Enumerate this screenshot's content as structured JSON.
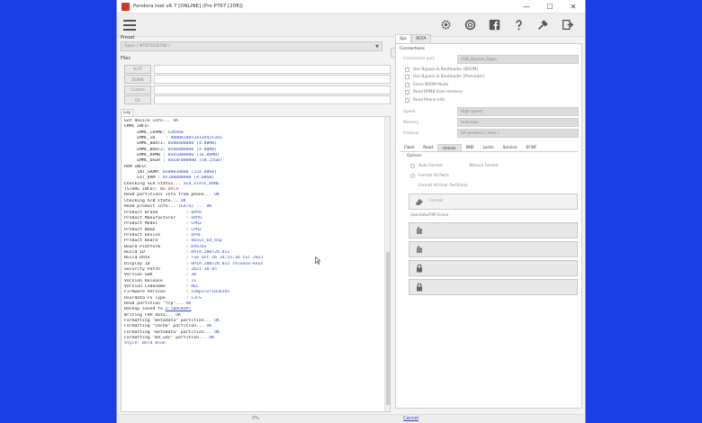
{
  "window": {
    "title": "Pandora tool v6.7 [ONLINE] (Pro P767 [208])",
    "minimize": "—",
    "maximize": "☐",
    "close": "✕"
  },
  "toolbar": {
    "icons": [
      "gear-icon",
      "lifebuoy-icon",
      "facebook-icon",
      "help-icon",
      "tools-icon",
      "export-icon"
    ]
  },
  "left": {
    "preset_label": "Preset",
    "preset_value": "Oppo  ( MT6765/6768 )",
    "files_label": "Files",
    "file_buttons": [
      "SCAT",
      "DOWN",
      "Custom",
      "DA"
    ],
    "log_tab": "Log"
  },
  "log": {
    "lines": [
      [
        [
          "Get device info... ",
          "k"
        ],
        [
          "OK",
          "v"
        ]
      ],
      [
        [
          "EMMC INFO:",
          "k"
        ]
      ],
      [
        [
          "     EMMC_CHAME: ",
          "k"
        ],
        [
          "G1K9da",
          "v"
        ]
      ],
      [
        [
          "     EMMC_ID    : ",
          "k"
        ],
        [
          "9B0B0100534134425341",
          "v"
        ]
      ],
      [
        [
          "     EMMC_BOOT1: ",
          "k"
        ],
        [
          "0x00400000 (4.00MB)",
          "v"
        ]
      ],
      [
        [
          "     EMMC_BOOT2: ",
          "k"
        ],
        [
          "0x00400000 (4.00MB)",
          "v"
        ]
      ],
      [
        [
          "     EMMC_RPMB : ",
          "k"
        ],
        [
          "0x01000000 (16.00MB)",
          "v"
        ]
      ],
      [
        [
          "     EMMC_USER : ",
          "k"
        ],
        [
          "0xE8F000000 (58.25GB)",
          "v"
        ]
      ],
      [
        [
          "RAM INFO:",
          "k"
        ]
      ],
      [
        [
          "     INT_SRAM: ",
          "k"
        ],
        [
          "0x00038000 (224.00KB)",
          "v"
        ]
      ],
      [
        [
          "     EXT_RAM : ",
          "k"
        ],
        [
          "0x100000000 (4.00GB)",
          "v"
        ]
      ],
      [
        [
          "Checking SLA status... ",
          "k"
        ],
        [
          "SLA_STATE_DONE",
          "v"
        ]
      ],
      [
        [
          "[STORE INFO]: ",
          "k"
        ],
        [
          "NO DATA",
          "r"
        ]
      ],
      [
        [
          "Read partitions info from phone... ",
          "k"
        ],
        [
          "OK",
          "v"
        ]
      ],
      [
        [
          "Checking A/B state... ",
          "k"
        ],
        [
          "OK",
          "v"
        ]
      ],
      [
        [
          "Read product info... ",
          "k"
        ],
        [
          "[EXT4] ... OK",
          "v"
        ]
      ],
      [
        [
          "Product Brand           : ",
          "k"
        ],
        [
          "OPPO",
          "v"
        ]
      ],
      [
        [
          "Product Manufacturer    : ",
          "k"
        ],
        [
          "OPPO",
          "v"
        ]
      ],
      [
        [
          "Product Model           : ",
          "k"
        ],
        [
          "CPH2",
          "v"
        ]
      ],
      [
        [
          "Product Name            : ",
          "k"
        ],
        [
          "CPH2",
          "v"
        ]
      ],
      [
        [
          "Product Device          : ",
          "k"
        ],
        [
          "OP4F",
          "v"
        ]
      ],
      [
        [
          "Product Board           : ",
          "k"
        ],
        [
          "k65v1_64_bsp",
          "v"
        ]
      ],
      [
        [
          "Board Platform          : ",
          "k"
        ],
        [
          "mt6765",
          "v"
        ]
      ],
      [
        [
          "Build ID                : ",
          "k"
        ],
        [
          "RP1A.200720.011",
          "v"
        ]
      ],
      [
        [
          "Build Date              : ",
          "k"
        ],
        [
          "Tue Oct 26 14:55:36 CST 2021",
          "v"
        ]
      ],
      [
        [
          "Display ID              : ",
          "k"
        ],
        [
          "RP1A.200720.011 release-keys",
          "v"
        ]
      ],
      [
        [
          "Security Patch          : ",
          "k"
        ],
        [
          "2021-10-05",
          "v"
        ]
      ],
      [
        [
          "Version SDK             : ",
          "k"
        ],
        [
          "30",
          "v"
        ]
      ],
      [
        [
          "Version Release         : ",
          "k"
        ],
        [
          "11",
          "v"
        ]
      ],
      [
        [
          "Version Codename        : ",
          "k"
        ],
        [
          "REL",
          "v"
        ]
      ],
      [
        [
          "Firmware Version        : ",
          "k"
        ],
        [
          "compiler1026145",
          "v"
        ]
      ],
      [
        [
          "Userdata FS Type        : ",
          "k"
        ],
        [
          "F2FS",
          "v"
        ]
      ],
      [
        [
          "Read partition \"frp\"... ",
          "k"
        ],
        [
          "OK",
          "v"
        ]
      ],
      [
        [
          "Backup saved to ",
          "k"
        ],
        [
          "Z:\\BACKUP\\",
          "u"
        ]
      ],
      [
        [
          "Writing FRP data... ",
          "k"
        ],
        [
          "OK",
          "v"
        ]
      ],
      [
        [
          "Formatting \"metadata\" partition... ",
          "k"
        ],
        [
          "OK",
          "v"
        ]
      ],
      [
        [
          "Formatting \"cache\" partition... ",
          "k"
        ],
        [
          "OK",
          "v"
        ]
      ],
      [
        [
          "Formatting \"metadata\" partition... ",
          "k"
        ],
        [
          "OK",
          "v"
        ]
      ],
      [
        [
          "Formatting \"md_udc\" partition... ",
          "k"
        ],
        [
          "OK",
          "v"
        ]
      ],
      [
        [
          "Style: Bold Blue",
          "v"
        ]
      ]
    ]
  },
  "right": {
    "tabs": [
      "Spc",
      "RCFA"
    ],
    "connections_label": "Connections",
    "fields": [
      {
        "label": "Connection port",
        "value": "USB_Bypass_Oppo"
      },
      {
        "label": "Speed",
        "value": "High speed"
      },
      {
        "label": "Memory",
        "value": "Unknown"
      },
      {
        "label": "Protocol",
        "value": "DA protocol ( Auto )"
      }
    ],
    "checkboxes": [
      "Use Bypass & Bootloader [BROM]",
      "Use Bypass & Bootloader [Preloader]",
      "Force BROM Mode",
      "Read RPMB from memory",
      "Read Phone Info"
    ],
    "subtabs": [
      "Flash",
      "Read",
      "Unlock",
      "IMEI",
      "Locks",
      "Service",
      "EFWF"
    ],
    "active_subtab": "Unlock",
    "options_label": "Options",
    "radios": [
      "Auto Format",
      "Manual Format",
      "Format All Parts",
      "Format All User Partitions"
    ],
    "buttons": [
      "Format",
      "",
      "",
      "",
      ""
    ],
    "section2_label": "Userdata/FRP Erase"
  },
  "status": {
    "mid": "0%",
    "link": "Cancel"
  }
}
